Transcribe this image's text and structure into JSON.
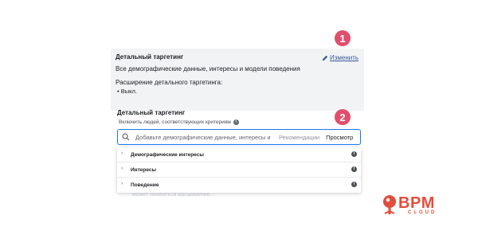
{
  "summary": {
    "title": "Детальный таргетинг",
    "edit_label": "Изменить",
    "description": "Все демографические данные, интересы и модели поведения",
    "expansion_label": "Расширение детального таргетинга:",
    "expansion_value": "Выкл."
  },
  "badges": {
    "one": "1",
    "two": "2"
  },
  "targeting": {
    "title": "Детальный таргетинг",
    "include_label": "Включить людей, соответствующих критериям",
    "search": {
      "placeholder": "Добавьте демографические данные, интересы и",
      "recommendations_label": "Рекомендации",
      "browse_label": "Просмотр"
    },
    "categories": [
      {
        "label": "Демографические интересы"
      },
      {
        "label": "Интересы"
      },
      {
        "label": "Поведение"
      }
    ]
  },
  "behind_text": "может появиться расширение...",
  "logo": {
    "text": "BPM",
    "subtext": "CLOUD"
  },
  "colors": {
    "accent": "#1877f2",
    "badge": "#e14e6c",
    "logo": "#e14e3e",
    "link": "#385898"
  }
}
